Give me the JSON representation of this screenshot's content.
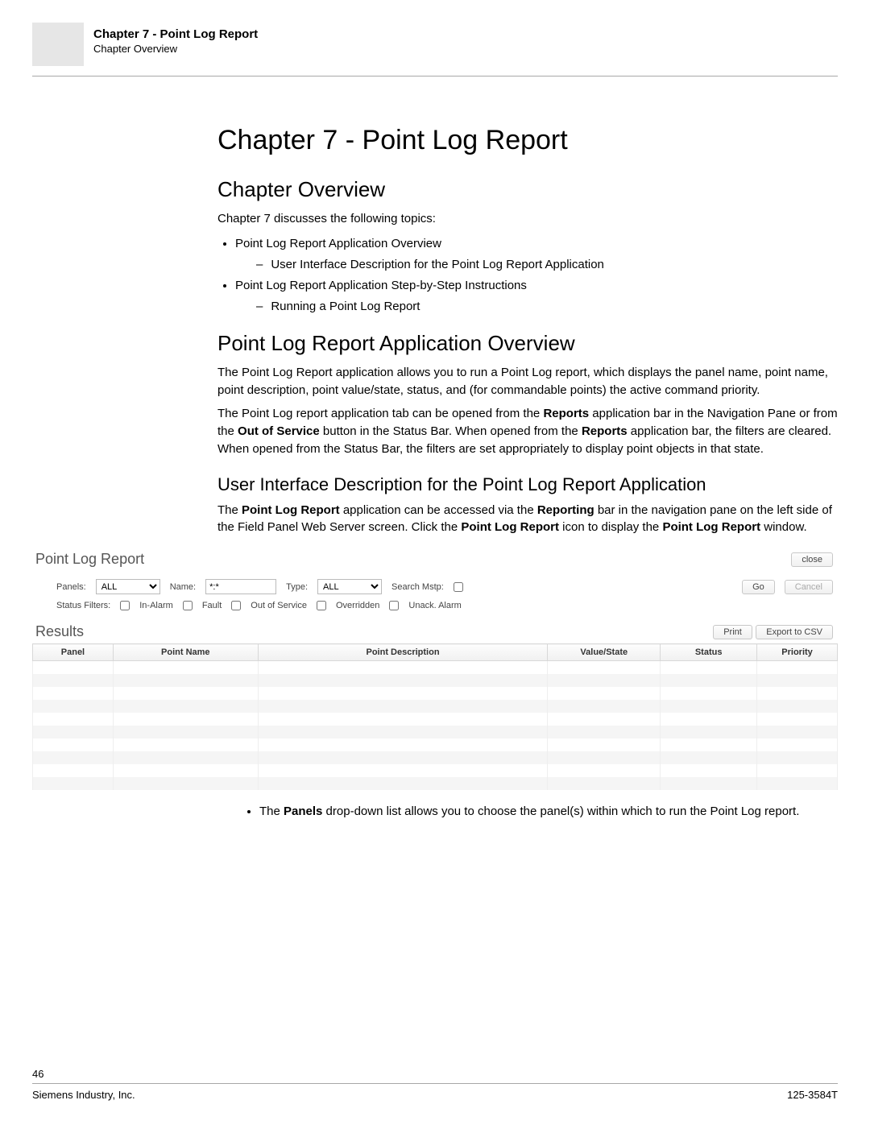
{
  "header": {
    "line1": "Chapter 7 - Point Log Report",
    "line2": "Chapter Overview"
  },
  "h1": "Chapter 7 - Point Log Report",
  "overview": {
    "heading": "Chapter Overview",
    "intro": "Chapter 7 discusses the following topics:",
    "b1": "Point Log Report Application Overview",
    "b1a": "User Interface Description for the Point Log Report Application",
    "b2": "Point Log Report Application Step-by-Step Instructions",
    "b2a": "Running a Point Log Report"
  },
  "appOverview": {
    "heading": "Point Log Report Application Overview",
    "p1": "The Point Log Report application allows you to run a Point Log report, which displays the panel name, point name, point description, point value/state, status, and (for commandable points) the active command priority.",
    "p2_1": "The Point Log report application tab can be opened from the ",
    "p2_b1": "Reports",
    "p2_2": " application bar in the Navigation Pane or from the ",
    "p2_b2": "Out of Service",
    "p2_3": " button in the Status Bar. When opened from the ",
    "p2_b3": "Reports",
    "p2_4": " application bar, the filters are cleared. When opened from the Status Bar, the filters are set appropriately to display point objects in that state."
  },
  "uiDesc": {
    "heading": "User Interface Description for the Point Log Report Application",
    "p1_1": "The ",
    "p1_b1": "Point Log Report",
    "p1_2": " application can be accessed via the ",
    "p1_b2": "Reporting",
    "p1_3": " bar in the navigation pane on the left side of the Field Panel Web Server screen. Click the ",
    "p1_b3": "Point Log Report",
    "p1_4": " icon to display the ",
    "p1_b4": "Point Log Report",
    "p1_5": " window."
  },
  "app": {
    "title": "Point Log Report",
    "close": "close",
    "lbl_panels": "Panels:",
    "sel_panels": "ALL",
    "lbl_name": "Name:",
    "val_name": "*:*",
    "lbl_type": "Type:",
    "sel_type": "ALL",
    "lbl_search": "Search Mstp:",
    "btn_go": "Go",
    "btn_cancel": "Cancel",
    "lbl_status": "Status Filters:",
    "f_inalarm": "In-Alarm",
    "f_fault": "Fault",
    "f_oos": "Out of Service",
    "f_over": "Overridden",
    "f_unack": "Unack. Alarm",
    "results": "Results",
    "btn_print": "Print",
    "btn_csv": "Export to CSV",
    "th_panel": "Panel",
    "th_pname": "Point Name",
    "th_pdesc": "Point Description",
    "th_val": "Value/State",
    "th_status": "Status",
    "th_prio": "Priority"
  },
  "post": {
    "li1_1": "The ",
    "li1_b": "Panels",
    "li1_2": " drop-down list allows you to choose the panel(s) within which to run the Point Log report."
  },
  "footer": {
    "page": "46",
    "left": "Siemens Industry, Inc.",
    "right": "125-3584T"
  }
}
